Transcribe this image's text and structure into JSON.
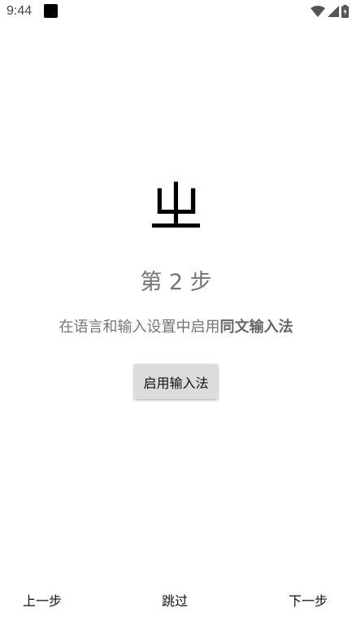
{
  "status_bar": {
    "time": "9:44",
    "icons": [
      "notification-square-icon",
      "wifi-icon",
      "cellular-signal-icon",
      "battery-charging-icon"
    ]
  },
  "main": {
    "hero_glyph": "ㄓ",
    "step_title": "第 2 步",
    "instruction_prefix": "在语言和输入设置中启用",
    "instruction_emphasis": "同文输入法",
    "enable_button": "启用输入法"
  },
  "bottom_nav": {
    "prev": "上一步",
    "skip": "跳过",
    "next": "下一步"
  }
}
